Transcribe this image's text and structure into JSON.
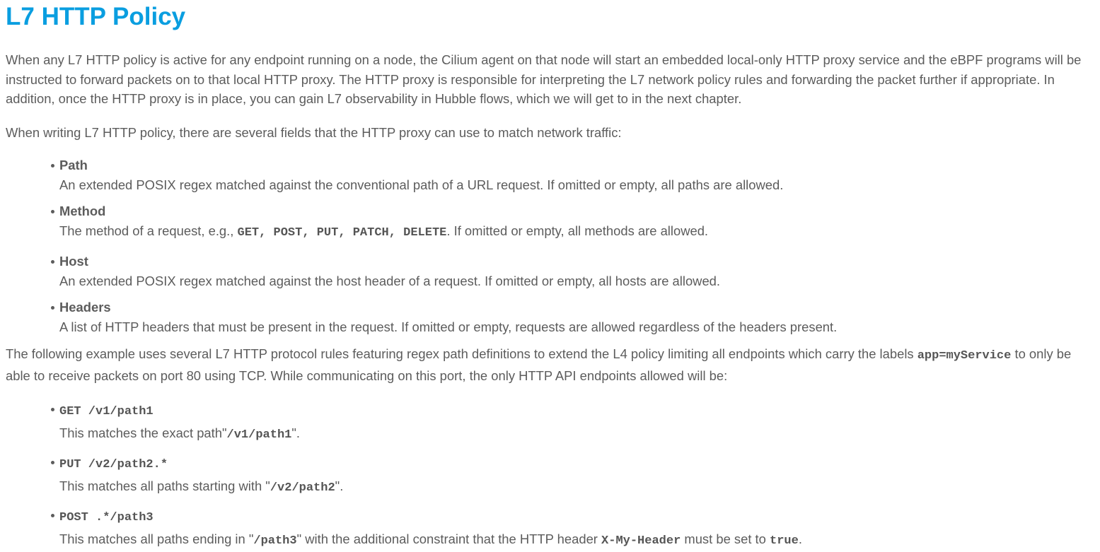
{
  "title": "L7 HTTP Policy",
  "intro": "When any L7 HTTP policy is active for any endpoint running on a node, the Cilium agent on that node will start an embedded local-only HTTP proxy service and the eBPF programs will be instructed to forward packets on to that local HTTP proxy. The HTTP proxy is responsible for interpreting the L7 network policy rules and forwarding the packet further if appropriate. In addition, once the HTTP proxy is in place, you can gain L7 observability in Hubble flows, which we will get to in the next chapter.",
  "fields_intro": "When writing L7 HTTP policy, there are several fields that the HTTP proxy can use to match network traffic:",
  "fields": [
    {
      "term": "Path",
      "desc": "An extended POSIX regex matched against the conventional path of a URL request. If omitted or empty, all paths are allowed."
    },
    {
      "term": "Method",
      "desc_pre": "The method of a request, e.g., ",
      "codes": "GET, POST, PUT, PATCH, DELETE",
      "desc_post": ". If omitted or empty, all methods are allowed."
    },
    {
      "term": "Host",
      "desc": "An extended POSIX regex matched against the host header of a request. If omitted or empty, all hosts are allowed."
    },
    {
      "term": "Headers",
      "desc": "A list of HTTP headers that must be present in the request. If omitted or empty, requests are allowed regardless of the headers present."
    }
  ],
  "example": {
    "pre": "The following example uses several L7 HTTP protocol rules featuring regex path definitions to extend the L4 policy limiting all endpoints which carry the labels ",
    "label": "app=myService",
    "post": " to only be able to receive packets on port 80 using TCP. While communicating on this port, the only HTTP API endpoints allowed will be:"
  },
  "rules": [
    {
      "rule": "GET /v1/path1",
      "pre": "This matches the exact path\"",
      "code": "/v1/path1",
      "post": "\"."
    },
    {
      "rule": "PUT /v2/path2.*",
      "pre": "This matches all paths starting with \"",
      "code": "/v2/path2",
      "post": "\"."
    },
    {
      "rule": "POST .*/path3",
      "pre": "This matches all paths ending in \"",
      "code": "/path3",
      "mid": "\" with the additional constraint that the HTTP header ",
      "code2": "X-My-Header",
      "mid2": " must be set to ",
      "code3": "true",
      "post": "."
    }
  ]
}
